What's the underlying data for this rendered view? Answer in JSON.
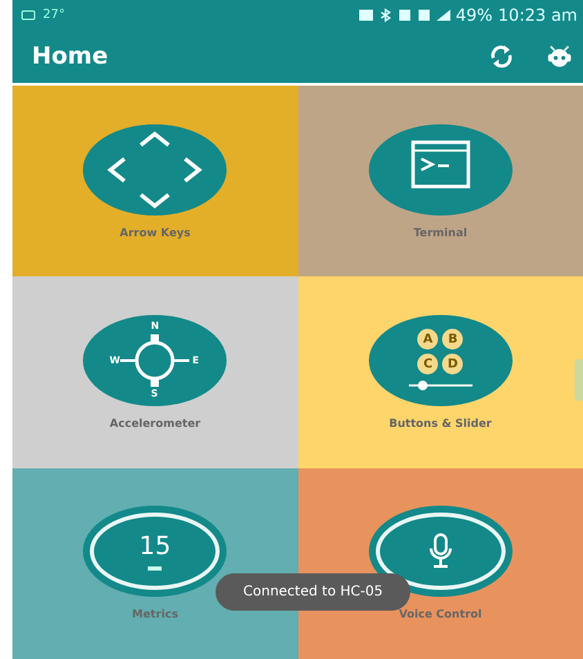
{
  "status_bar": {
    "temperature": "27°",
    "battery": "49%",
    "time": "10:23 am"
  },
  "app_bar": {
    "title": "Home"
  },
  "tiles": [
    {
      "kind": "arrows",
      "label": "Arrow Keys",
      "color": "#e3ae28"
    },
    {
      "kind": "terminal",
      "label": "Terminal",
      "color": "#bfa587"
    },
    {
      "kind": "compass",
      "label": "Accelerometer",
      "color": "#cfcfcf",
      "glyphs": [
        "N",
        "W",
        "E",
        "S"
      ]
    },
    {
      "kind": "buttons",
      "label": "Buttons & Slider",
      "color": "#fdd56b",
      "glyphs": [
        "A",
        "B",
        "C",
        "D"
      ]
    },
    {
      "kind": "metrics",
      "label": "Metrics",
      "color": "#62aeb0",
      "glyphs": [
        "15"
      ]
    },
    {
      "kind": "voice",
      "label": "Voice Control",
      "color": "#e8935e"
    }
  ],
  "toast": {
    "text": "Connected to HC-05"
  }
}
